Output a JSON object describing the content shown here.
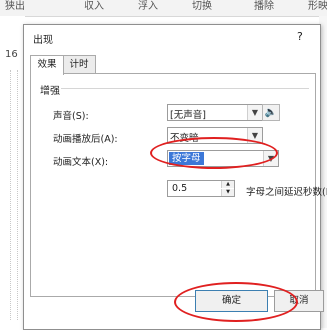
{
  "ribbon": {
    "tabs": [
      "狭出",
      "収入",
      "浮入",
      "切换",
      "播除",
      "形映"
    ]
  },
  "ruler": {
    "marker": "16"
  },
  "dialog": {
    "title": "出现",
    "help": "?",
    "tabs": [
      "效果",
      "计时"
    ],
    "group": "增强",
    "sound": {
      "label": "声音(S):",
      "value": "[无声音]"
    },
    "after_animation": {
      "label": "动画播放后(A):",
      "value": "不变暗"
    },
    "animate_text": {
      "label": "动画文本(X):",
      "value": "按字母"
    },
    "delay": {
      "value": "0.5",
      "label": "字母之间延迟秒数(D)"
    },
    "buttons": {
      "ok": "确定",
      "cancel": "取消"
    }
  },
  "colors": {
    "highlight": "#3c78d8",
    "annotation": "#e02020"
  },
  "icons": {
    "sound": "speaker-icon",
    "dropdown": "chevron-down-icon"
  }
}
